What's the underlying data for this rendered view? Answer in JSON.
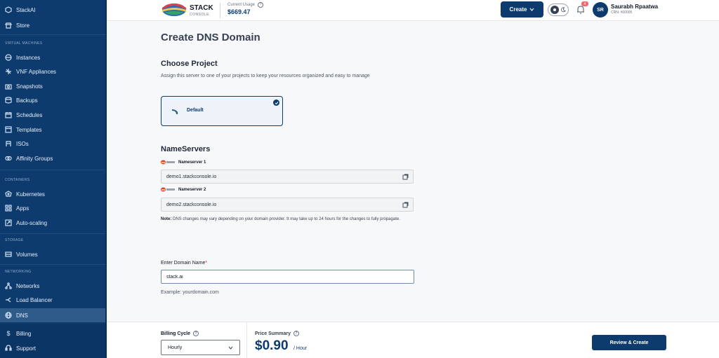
{
  "sidebar": {
    "brand": "StackAI",
    "store": "Store",
    "sections": {
      "vm": "VIRTUAL MACHINES",
      "containers": "CONTAINERS",
      "storage": "STORAGE",
      "networking": "NETWORKING"
    },
    "items": {
      "instances": "Instances",
      "vnf": "VNF Appliances",
      "snapshots": "Snapshots",
      "backups": "Backups",
      "schedules": "Schedules",
      "templates": "Templates",
      "isos": "ISOs",
      "affinity": "Affinity Groups",
      "kubernetes": "Kubernetes",
      "apps": "Apps",
      "autoscaling": "Auto-scaling",
      "volumes": "Volumes",
      "networks": "Networks",
      "loadbalancer": "Load Balancer",
      "dns": "DNS",
      "billing": "Billing",
      "support": "Support"
    },
    "active": "dns"
  },
  "header": {
    "logo_text": "STACK",
    "logo_sub": "CONSOLE",
    "usage_label": "Current Usage",
    "usage_value": "$669.47",
    "create_label": "Create",
    "notification_count": "4",
    "avatar_initials": "SR",
    "user_name": "Saurabh Rpaatwa",
    "user_crn": "CRN: #00005"
  },
  "main": {
    "title": "Create DNS Domain",
    "choose_project_title": "Choose Project",
    "choose_project_sub": "Assign this server to one of your projects to keep your resources organized and easy to manage",
    "project_label": "Default",
    "nameservers_title": "NameServers",
    "ns1_label": "Nameserver 1",
    "ns1_value": "demo1.stackconsole.io",
    "ns2_label": "Nameserver 2",
    "ns2_value": "demo2.stackconsole.io",
    "note_bold": "Note:",
    "note_text": " DNS changes may vary depending on your domain provider. It may take up to 24 hours for the changes to fully propagate.",
    "domain_label": "Enter Domain Name",
    "domain_required": "*",
    "domain_value": "stack.ai",
    "example": "Example: yourdomain.com"
  },
  "footer": {
    "billing_cycle_label": "Billing Cycle",
    "billing_cycle_value": "Hourly",
    "price_summary_label": "Price Summary",
    "price": "$0.90",
    "per": "/ Hour",
    "review_label": "Review & Create"
  },
  "colors": {
    "primary": "#0d3b6e",
    "sidebar_active": "#2f5b8a",
    "required": "#dc2626"
  }
}
